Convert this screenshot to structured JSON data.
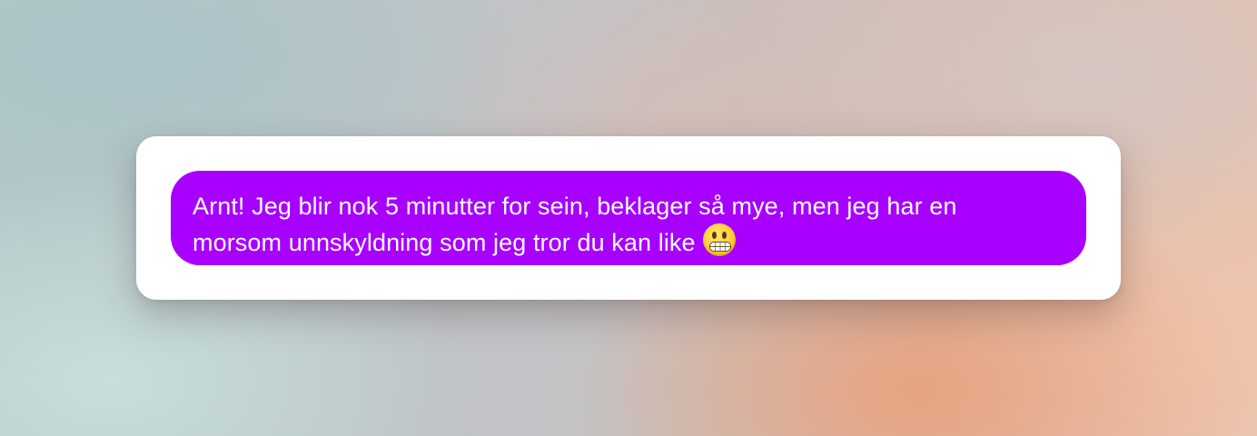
{
  "message": {
    "line1": "Arnt! Jeg blir nok 5 minutter for sein, beklager så mye, men jeg har en",
    "line2": "morsom unnskyldning som jeg tror du kan like",
    "emoji": "grimacing-face",
    "bubble_color": "#a800ff",
    "text_color": "#ffffff"
  },
  "card": {
    "background": "#ffffff"
  }
}
